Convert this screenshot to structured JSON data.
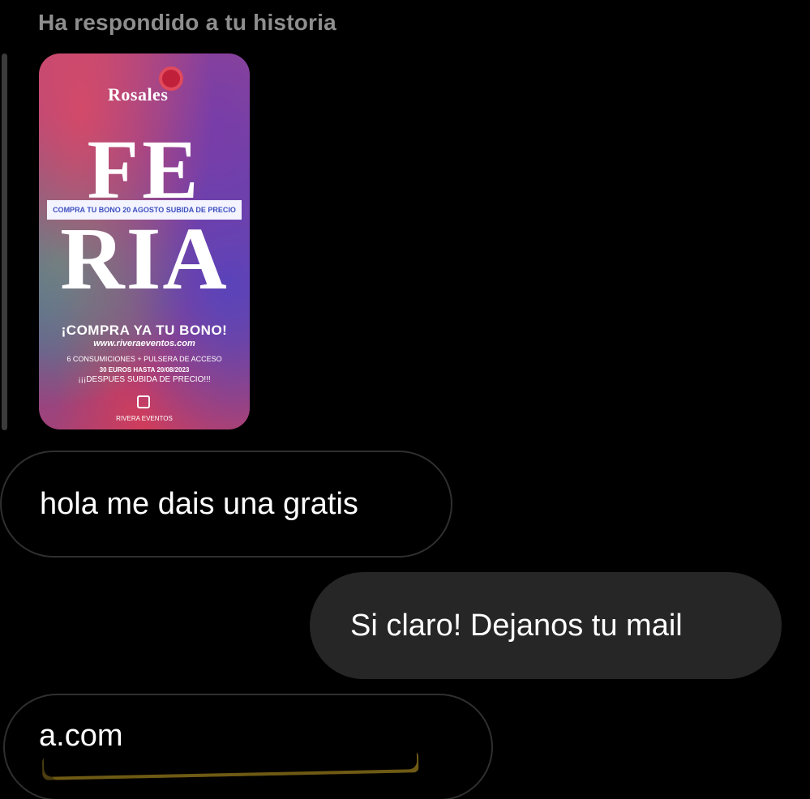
{
  "header": {
    "reply_label": "Ha respondido a tu historia"
  },
  "story": {
    "logo_text": "Rosales",
    "headline_top": "FE",
    "headline_bottom": "RIA",
    "banner": "COMPRA TU BONO 20 AGOSTO SUBIDA DE PRECIO",
    "cta": "¡COMPRA YA TU BONO!",
    "url": "www.riveraeventos.com",
    "line1": "6 CONSUMICIONES + PULSERA DE ACCESO",
    "line2": "30 EUROS HASTA 20/08/2023",
    "line3": "¡¡¡DESPUES SUBIDA DE PRECIO!!!",
    "brand": "RIVERA EVENTOS"
  },
  "messages": [
    {
      "direction": "incoming",
      "text": "hola me dais una gratis"
    },
    {
      "direction": "outgoing",
      "text": "Si claro! Dejanos tu mail"
    },
    {
      "direction": "incoming",
      "text": "a.com",
      "redacted": true
    }
  ],
  "colors": {
    "background": "#000000",
    "incoming_border": "#2f2f2f",
    "outgoing_bubble": "#262626",
    "meta_text": "#8e8e8e"
  }
}
